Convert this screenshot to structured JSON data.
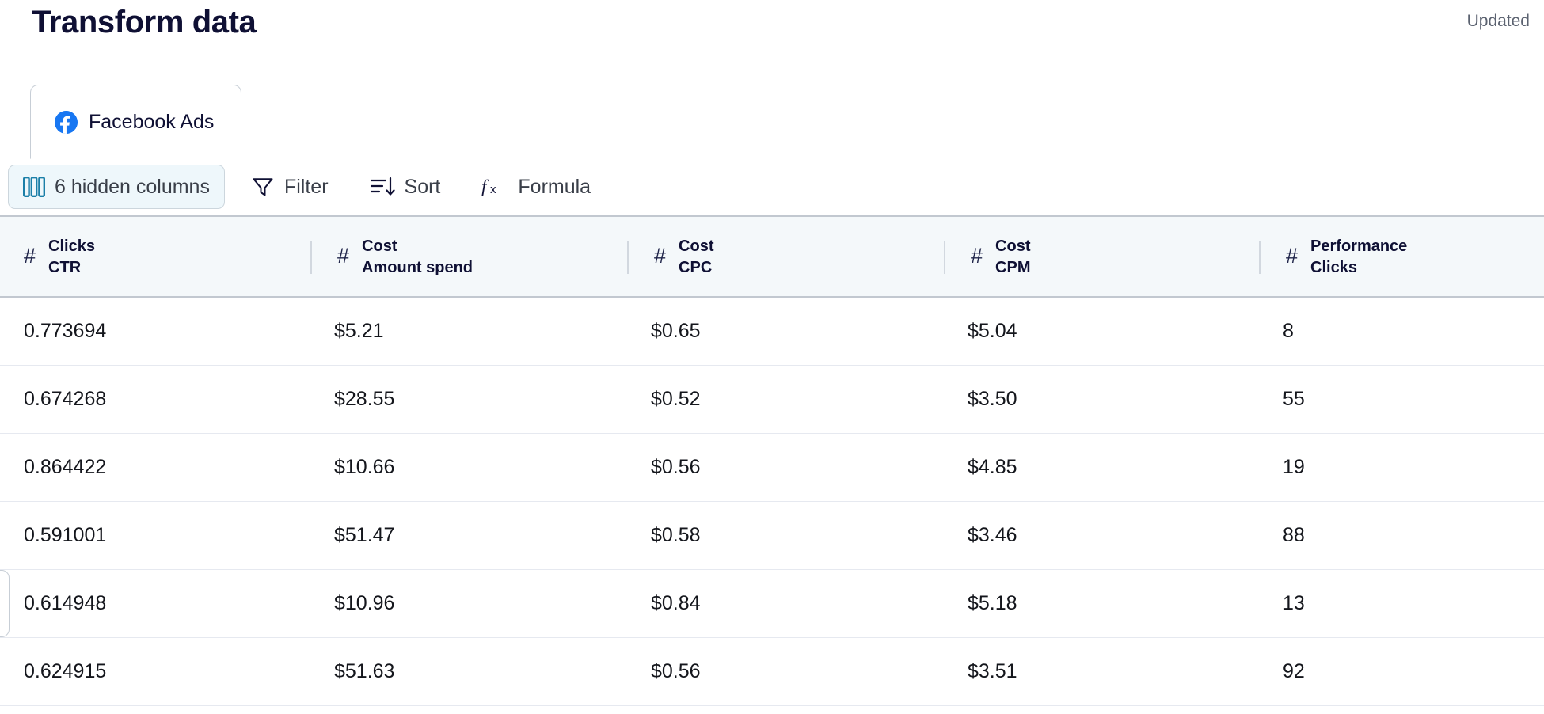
{
  "header": {
    "title": "Transform data",
    "updated_label": "Updated"
  },
  "tabs": [
    {
      "label": "Facebook Ads",
      "icon": "facebook-icon",
      "active": true
    }
  ],
  "toolbar": {
    "hidden_columns_label": "6 hidden columns",
    "hidden_columns_icon": "columns-icon",
    "filter_label": "Filter",
    "filter_icon": "filter-funnel-icon",
    "sort_label": "Sort",
    "sort_icon": "sort-descending-icon",
    "formula_label": "Formula",
    "formula_icon": "fx-formula-icon"
  },
  "table": {
    "columns": [
      {
        "type_icon": "number-type-icon",
        "group": "Clicks",
        "field": "CTR"
      },
      {
        "type_icon": "number-type-icon",
        "group": "Cost",
        "field": "Amount spend"
      },
      {
        "type_icon": "number-type-icon",
        "group": "Cost",
        "field": "CPC"
      },
      {
        "type_icon": "number-type-icon",
        "group": "Cost",
        "field": "CPM"
      },
      {
        "type_icon": "number-type-icon",
        "group": "Performance",
        "field": "Clicks"
      }
    ],
    "rows": [
      {
        "ctr": "0.773694",
        "amount_spend": "$5.21",
        "cpc": "$0.65",
        "cpm": "$5.04",
        "clicks": "8",
        "focused": false
      },
      {
        "ctr": "0.674268",
        "amount_spend": "$28.55",
        "cpc": "$0.52",
        "cpm": "$3.50",
        "clicks": "55",
        "focused": false
      },
      {
        "ctr": "0.864422",
        "amount_spend": "$10.66",
        "cpc": "$0.56",
        "cpm": "$4.85",
        "clicks": "19",
        "focused": false
      },
      {
        "ctr": "0.591001",
        "amount_spend": "$51.47",
        "cpc": "$0.58",
        "cpm": "$3.46",
        "clicks": "88",
        "focused": false
      },
      {
        "ctr": "0.614948",
        "amount_spend": "$10.96",
        "cpc": "$0.84",
        "cpm": "$5.18",
        "clicks": "13",
        "focused": true
      },
      {
        "ctr": "0.624915",
        "amount_spend": "$51.63",
        "cpc": "$0.56",
        "cpm": "$3.51",
        "clicks": "92",
        "focused": false
      }
    ]
  },
  "colors": {
    "brand_facebook": "#1877f2",
    "accent_teal": "#1b7fa8",
    "header_bg": "#f4f8fa",
    "pill_bg": "#eef7fb",
    "text_dark": "#0f1034",
    "border": "#c7ced6"
  }
}
